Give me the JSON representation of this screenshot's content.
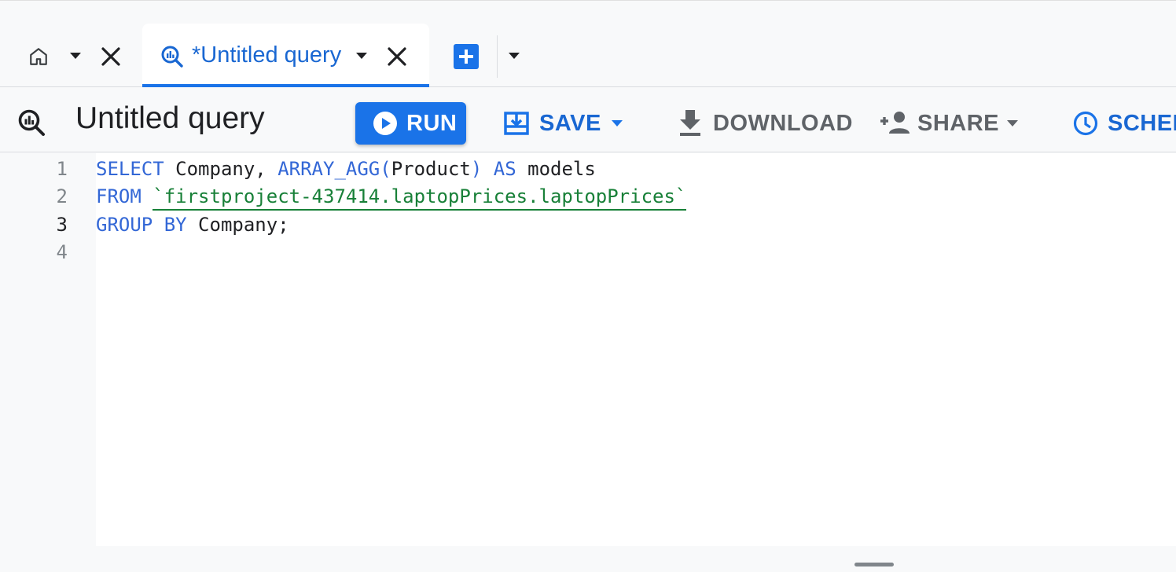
{
  "tabs": {
    "home_tab": {
      "icon": "home-icon"
    },
    "active_tab": {
      "icon": "query-icon",
      "title": "*Untitled query"
    },
    "new_tab": {
      "icon": "add-box-icon"
    }
  },
  "toolbar": {
    "query_icon": "query-icon",
    "query_title": "Untitled query",
    "run_label": "RUN",
    "save_label": "SAVE",
    "download_label": "DOWNLOAD",
    "share_label": "SHARE",
    "schedule_label": "SCHED"
  },
  "editor": {
    "line_numbers": [
      "1",
      "2",
      "3",
      "4"
    ],
    "current_line": "3",
    "lines": [
      {
        "kw1": "SELECT",
        "t1": " Company, ",
        "kw2": "ARRAY_AGG(",
        "t2": "Product",
        "kw3": ")",
        "t3": " ",
        "kw4": "AS",
        "t4": " models"
      },
      {
        "kw1": "FROM",
        "t1": " ",
        "str": "`firstproject-437414.laptopPrices.laptopPrices`"
      },
      {
        "kw1": "GROUP",
        "t1": " ",
        "kw2": "BY",
        "t2": " Company;"
      },
      {}
    ]
  },
  "colors": {
    "accent": "#1a73e8",
    "keyword": "#3367d6",
    "string": "#188038"
  }
}
